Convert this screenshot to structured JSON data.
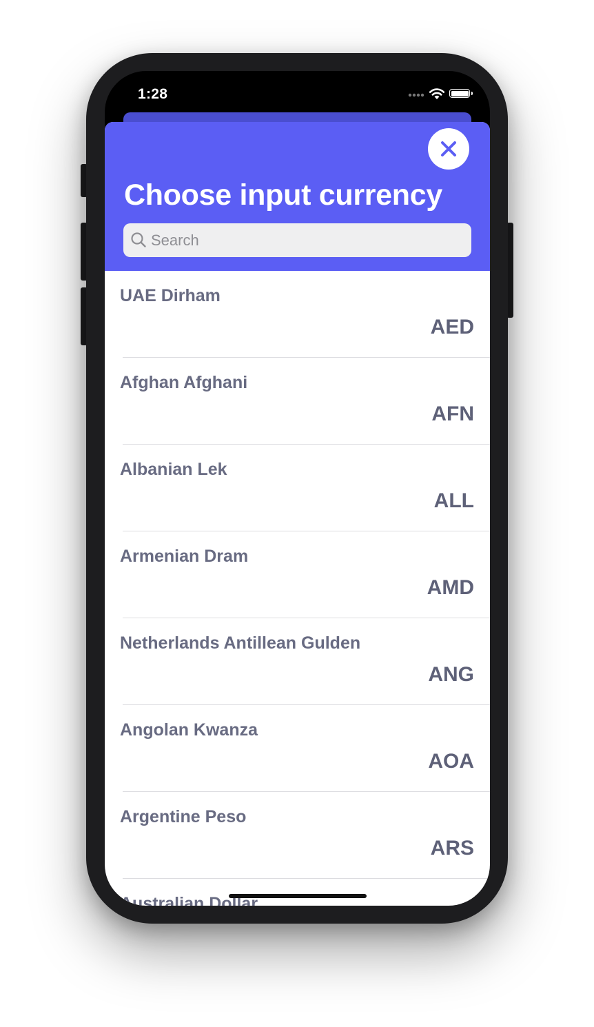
{
  "status_bar": {
    "time": "1:28"
  },
  "modal": {
    "title": "Choose input currency",
    "search": {
      "placeholder": "Search",
      "value": ""
    },
    "accent_color": "#5b5ef4"
  },
  "currencies": [
    {
      "name": "UAE Dirham",
      "code": "AED"
    },
    {
      "name": "Afghan Afghani",
      "code": "AFN"
    },
    {
      "name": "Albanian Lek",
      "code": "ALL"
    },
    {
      "name": "Armenian Dram",
      "code": "AMD"
    },
    {
      "name": "Netherlands Antillean Gulden",
      "code": "ANG"
    },
    {
      "name": "Angolan Kwanza",
      "code": "AOA"
    },
    {
      "name": "Argentine Peso",
      "code": "ARS"
    },
    {
      "name": "Australian Dollar",
      "code": ""
    }
  ]
}
